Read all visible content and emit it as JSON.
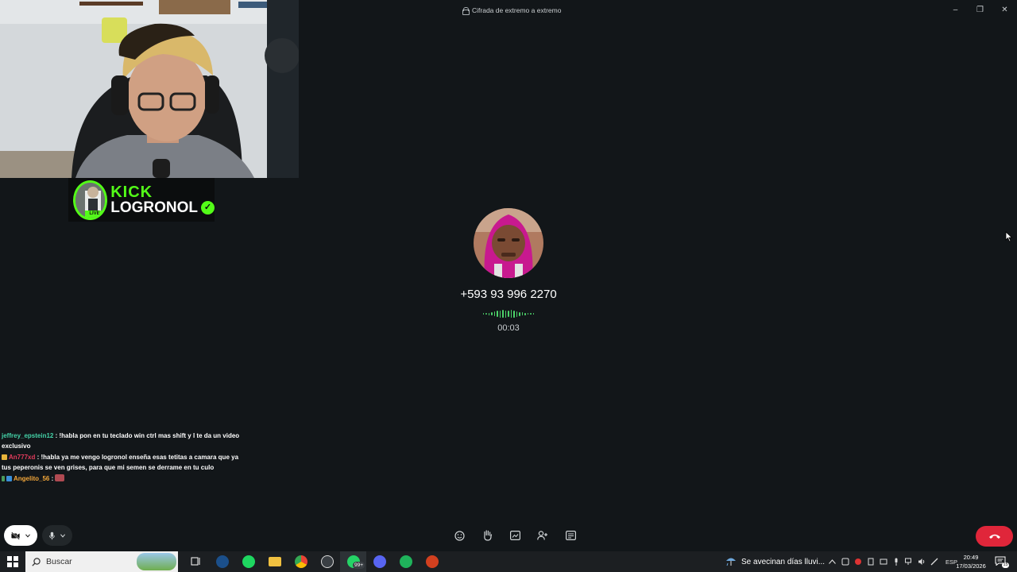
{
  "window": {
    "title": "Cifrada de extremo a extremo",
    "controls": {
      "minimize": "–",
      "maximize": "❐",
      "close": "✕"
    }
  },
  "overlay": {
    "brand": "KICK",
    "channel": "LOGRONOL",
    "live_label": "LIVE",
    "verified": "✓"
  },
  "call": {
    "number": "+593 93 996 2270",
    "timer": "00:03",
    "colors": {
      "end_call": "#e0263a",
      "waveform": "#4dd36a"
    }
  },
  "chat": [
    {
      "user": "jeffrey_epstein12",
      "sep": " : ",
      "text": "!habla pon en tu teclado win ctrl mas shift y l te da un video exclusivo"
    },
    {
      "user": "An777xd",
      "sep": " : ",
      "text": "!habla ya me vengo logronol enseña esas tetitas a camara que ya tus peperonis se ven grises, para que mi semen se derrame en tu culo"
    },
    {
      "user": "Angelito_56",
      "sep": " : ",
      "text": ""
    }
  ],
  "controls": {
    "camera": "camera-off-icon",
    "mic": "mic-icon",
    "center": [
      "emoji-icon",
      "raise-hand-icon",
      "screen-share-icon",
      "add-person-icon",
      "more-options-icon"
    ],
    "end_call": "end-call-icon"
  },
  "taskbar": {
    "search_placeholder": "Buscar",
    "apps": [
      "task-view",
      "steam",
      "spotify",
      "file-explorer",
      "chrome",
      "game-app",
      "whatsapp",
      "discord",
      "edge-app",
      "other-app"
    ],
    "whatsapp_badge": "99+",
    "weather": "Se avecinan días lluvi...",
    "language": "ESP",
    "time": "20:49",
    "date": "17/03/2026",
    "notifications": "15"
  }
}
